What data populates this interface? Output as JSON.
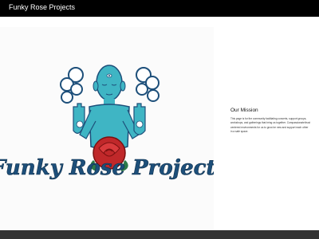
{
  "site": {
    "title": "Funky Rose Projects"
  },
  "hero": {
    "logo_text": "Funky Rose Projects",
    "colors": {
      "turquoise": "#3fb5c4",
      "navy": "#1d4f7a",
      "rose": "#c0282a",
      "leaf": "#2d7a4a"
    }
  },
  "mission": {
    "title": "Our Mission",
    "body": "This page is for the community facilitating concerts, support groups, workshops, and gatherings that bring us together. Compassionate/trust centered environments for us to grow be new and support each other in a safe space."
  },
  "colors": {
    "topbar": "#000000",
    "footer": "#333333"
  }
}
